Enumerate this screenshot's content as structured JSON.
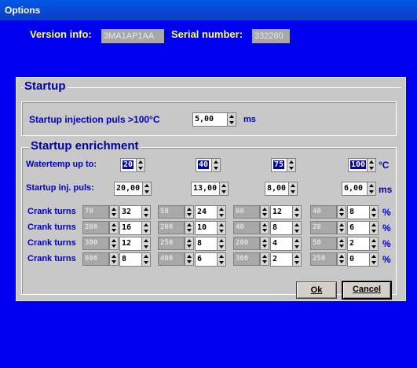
{
  "window": {
    "title": "Options"
  },
  "version": {
    "label": "Version info:",
    "value": "3MA1AP1AA",
    "serial_label": "Serial number:",
    "serial_value": "332280"
  },
  "startup": {
    "title": "Startup",
    "injection_label": "Startup injection puls >100°C",
    "injection_value": "5,00",
    "injection_unit": "ms"
  },
  "enrichment": {
    "title": "Startup enrichment",
    "watertemp_label": "Watertemp up to:",
    "watertemp_values": [
      "20",
      "40",
      "75",
      "100"
    ],
    "watertemp_unit": "°C",
    "inj_label": "Startup inj. puls:",
    "inj_values": [
      "20,00",
      "13,00",
      "8,00",
      "6,00"
    ],
    "inj_unit": "ms",
    "crank_label": "Crank turns",
    "crank_unit": "%",
    "crank_rows": [
      [
        [
          "70",
          "32"
        ],
        [
          "50",
          "24"
        ],
        [
          "60",
          "12"
        ],
        [
          "40",
          "8"
        ]
      ],
      [
        [
          "200",
          "16"
        ],
        [
          "200",
          "10"
        ],
        [
          "40",
          "8"
        ],
        [
          "20",
          "6"
        ]
      ],
      [
        [
          "300",
          "12"
        ],
        [
          "250",
          "8"
        ],
        [
          "200",
          "4"
        ],
        [
          "50",
          "2"
        ]
      ],
      [
        [
          "600",
          "8"
        ],
        [
          "400",
          "6"
        ],
        [
          "300",
          "2"
        ],
        [
          "250",
          "0"
        ]
      ]
    ]
  },
  "buttons": {
    "ok": "Ok",
    "cancel": "Cancel"
  }
}
